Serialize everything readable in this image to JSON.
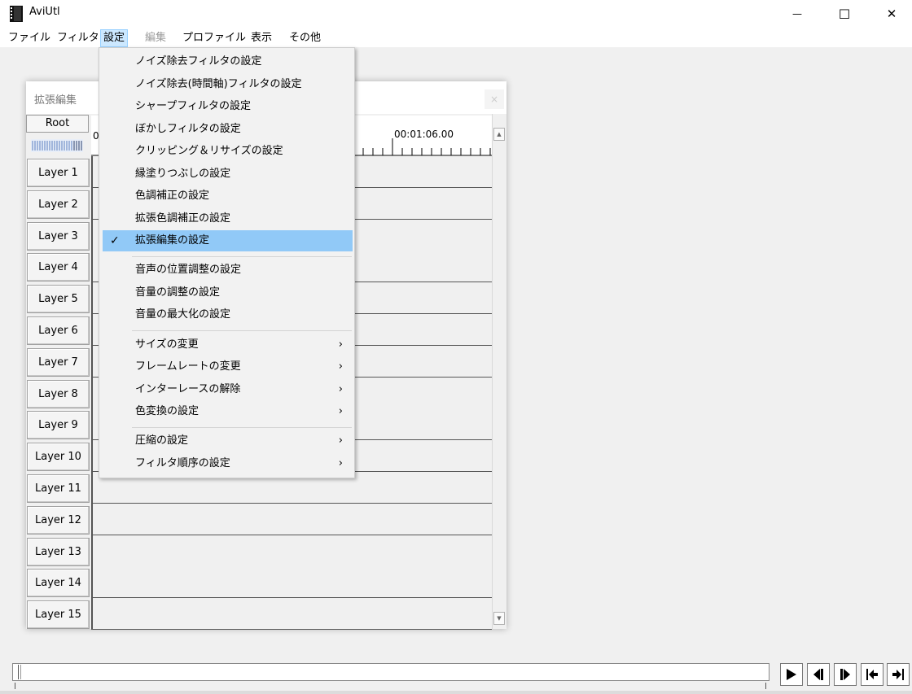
{
  "window": {
    "title": "AviUtl",
    "minimize": "—",
    "maximize": "☐",
    "close": "✕"
  },
  "menubar": {
    "items": [
      "ファイル",
      "フィルタ",
      "設定",
      "編集",
      "プロファイル",
      "表示",
      "その他"
    ]
  },
  "timeline": {
    "title": "拡張編集",
    "close_label": "×",
    "root_label": "Root",
    "ruler_start": "0",
    "ruler_time": "00:01:06.00",
    "layers": [
      "Layer 1",
      "Layer 2",
      "Layer 3",
      "Layer 4",
      "Layer 5",
      "Layer 6",
      "Layer 7",
      "Layer 8",
      "Layer 9",
      "Layer 10",
      "Layer 11",
      "Layer 12",
      "Layer 13",
      "Layer 14",
      "Layer 15"
    ]
  },
  "dropdown": {
    "items": [
      {
        "label": "ノイズ除去フィルタの設定"
      },
      {
        "label": "ノイズ除去(時間軸)フィルタの設定"
      },
      {
        "label": "シャープフィルタの設定"
      },
      {
        "label": "ぼかしフィルタの設定"
      },
      {
        "label": "クリッピング＆リサイズの設定"
      },
      {
        "label": "縁塗りつぶしの設定"
      },
      {
        "label": "色調補正の設定"
      },
      {
        "label": "拡張色調補正の設定"
      },
      {
        "label": "拡張編集の設定",
        "checked": true
      },
      {
        "label": "音声の位置調整の設定"
      },
      {
        "label": "音量の調整の設定"
      },
      {
        "label": "音量の最大化の設定"
      },
      {
        "label": "サイズの変更",
        "submenu": true
      },
      {
        "label": "フレームレートの変更",
        "submenu": true
      },
      {
        "label": "インターレースの解除",
        "submenu": true
      },
      {
        "label": "色変換の設定",
        "submenu": true
      },
      {
        "label": "圧縮の設定",
        "submenu": true
      },
      {
        "label": "フィルタ順序の設定",
        "submenu": true
      }
    ],
    "check_glyph": "✓",
    "submenu_glyph": "›"
  },
  "colors": {
    "menu_highlight": "#91c9f7",
    "open_menu": "#cce8ff"
  }
}
